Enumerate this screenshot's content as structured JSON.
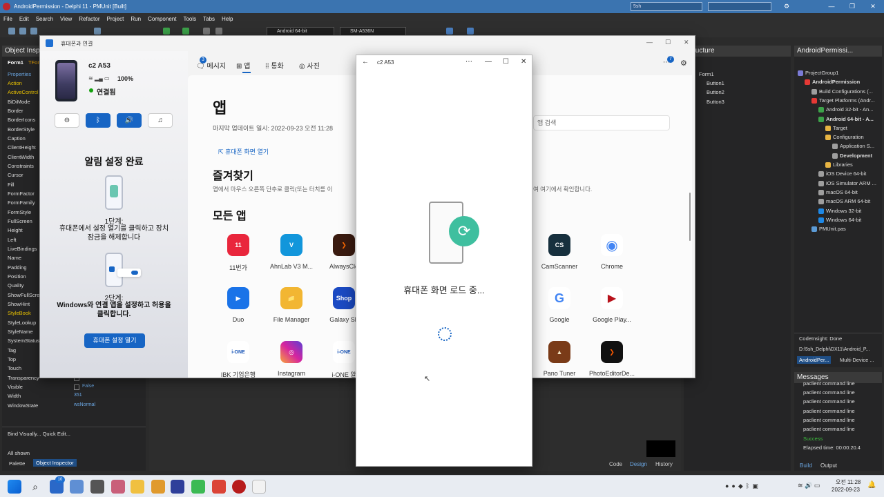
{
  "ide": {
    "title": "AndroidPermission - Delphi 11 - PMUnit [Built]",
    "search_value": "5sh",
    "menu": [
      "File",
      "Edit",
      "Search",
      "View",
      "Refactor",
      "Project",
      "Run",
      "Component",
      "Tools",
      "Tabs",
      "Help"
    ],
    "platform_combo": "Android 64-bit",
    "device_combo": "SM-A536N",
    "object_inspector": {
      "title": "Object Inspector",
      "form_name": "Form1",
      "form_type": "TForm1",
      "tab_properties": "Properties",
      "rows": [
        "Action",
        "ActiveControl",
        "BiDiMode",
        "Border",
        "BorderIcons",
        "BorderStyle",
        "Caption",
        "ClientHeight",
        "ClientWidth",
        "Constraints",
        "Cursor",
        "Fill",
        "FormFactor",
        "FormFamily",
        "FormStyle",
        "FullScreen",
        "Height",
        "Left",
        "LiveBindings",
        "Name",
        "Padding",
        "Position",
        "Quality",
        "ShowFullScreen",
        "ShowHint",
        "StyleBook",
        "StyleLookup",
        "StyleName",
        "SystemStatus",
        "Tag",
        "Top",
        "Touch",
        "Transparency",
        "Visible",
        "Width",
        "WindowState"
      ],
      "transparency_value": "False",
      "visible_value": "False",
      "width_value": "351",
      "windowstate_value": "wsNormal",
      "footer_links": "Bind Visually...  Quick Edit...",
      "all_shown": "All shown",
      "bottom_tabs": [
        "Palette",
        "Object Inspector"
      ]
    },
    "structure": {
      "title": "Structure",
      "items": [
        "Form1",
        "Button1",
        "Button2",
        "Button3"
      ]
    },
    "project_manager": {
      "title": "AndroidPermissi...",
      "items": [
        {
          "label": "ProjectGroup1",
          "indent": 0
        },
        {
          "label": "AndroidPermission",
          "indent": 1,
          "bold": true
        },
        {
          "label": "Build Configurations (...",
          "indent": 2
        },
        {
          "label": "Target Platforms (Andr...",
          "indent": 2
        },
        {
          "label": "Android 32-bit - An...",
          "indent": 3
        },
        {
          "label": "Android 64-bit - A...",
          "indent": 3,
          "bold": true
        },
        {
          "label": "Target",
          "indent": 4
        },
        {
          "label": "Configuration",
          "indent": 4
        },
        {
          "label": "Application S...",
          "indent": 5
        },
        {
          "label": "Development",
          "indent": 5,
          "bold": true
        },
        {
          "label": "Libraries",
          "indent": 4
        },
        {
          "label": "iOS Device 64-bit",
          "indent": 3
        },
        {
          "label": "iOS Simulator ARM ...",
          "indent": 3
        },
        {
          "label": "macOS 64-bit",
          "indent": 3
        },
        {
          "label": "macOS ARM 64-bit",
          "indent": 3
        },
        {
          "label": "Windows 32-bit",
          "indent": 3
        },
        {
          "label": "Windows 64-bit",
          "indent": 3
        },
        {
          "label": "PMUnit.pas",
          "indent": 2
        }
      ],
      "codeinsight": "CodeInsight: Done",
      "path": "D:\\5sh_Delphi\\DX11\\Android_P...",
      "tabs": [
        "AndroidPer...",
        "Multi-Device ..."
      ]
    },
    "messages": {
      "title": "Messages",
      "rows": [
        "paclient command line",
        "paclient command line",
        "paclient command line",
        "paclient command line",
        "paclient command line",
        "paclient command line"
      ],
      "success": "Success",
      "elapsed": "Elapsed time: 00:00:20.4",
      "tabs": [
        "Build",
        "Output"
      ]
    },
    "designer_tabs": [
      "Code",
      "Design",
      "History"
    ]
  },
  "phone_link": {
    "title": "휴대폰과 연결",
    "device_name": "c2 A53",
    "battery": "100%",
    "connected": "연결됨",
    "setup": {
      "title": "알림 설정 완료",
      "step1_heading": "1단계:",
      "step1_text": "휴대폰에서 설정 열기를 클릭하고 장치 잠금을 해제합니다",
      "step2_heading": "2단계:",
      "step2_text": "Windows와 연결 앱을 설정하고 허용을 클릭합니다.",
      "open_button": "휴대폰 설정 열기"
    },
    "tabs": [
      {
        "label": "메시지",
        "badge": "3"
      },
      {
        "label": "앱"
      },
      {
        "label": "통화"
      },
      {
        "label": "사진"
      }
    ],
    "notification_badge": "7",
    "apps_page": {
      "heading": "앱",
      "last_updated": "마지막 업데이트 일시: 2022-09-23 오전 11:28",
      "open_screen_link": "휴대폰 화면 열기",
      "search_placeholder": "앱 검색",
      "favorites_heading": "즐겨찾기",
      "favorites_hint_left": "앱에서 마우스 오른쪽 단추로 클릭(또는 터치를 이",
      "favorites_hint_right": "여 여기에서 확인합니다.",
      "all_apps_heading": "모든 앱",
      "apps_left": [
        {
          "name": "11번가",
          "glyph": "11",
          "color": "#e9263c"
        },
        {
          "name": "AhnLab V3 M...",
          "glyph": "V",
          "color": "#1296db"
        },
        {
          "name": "AlwaysClo",
          "glyph": "❯",
          "color": "#3a1b10"
        },
        {
          "name": "Duo",
          "glyph": "▶",
          "color": "#1a73e8"
        },
        {
          "name": "File Manager",
          "glyph": "📁",
          "color": "#f2b632"
        },
        {
          "name": "Galaxy Sh",
          "glyph": "Shop",
          "color": "#1b4ac3"
        },
        {
          "name": "IBK 기업은행",
          "glyph": "i-ONE",
          "color": "#ffffff"
        },
        {
          "name": "Instagram",
          "glyph": "◎",
          "color": "#d6249f"
        },
        {
          "name": "i-ONE 알",
          "glyph": "i-ONE",
          "color": "#ffffff"
        }
      ],
      "apps_right": [
        {
          "name": "CamScanner",
          "glyph": "CS",
          "color": "#17303e"
        },
        {
          "name": "Chrome",
          "glyph": "◉",
          "color": "#4285f4"
        },
        {
          "name": "Google",
          "glyph": "G",
          "color": "#ffffff"
        },
        {
          "name": "Google Play...",
          "glyph": "▶",
          "color": "#b8121b"
        },
        {
          "name": "Pano Tuner",
          "glyph": "▲",
          "color": "#7a3b18"
        },
        {
          "name": "PhotoEditorDe...",
          "glyph": "❯",
          "color": "#111111"
        }
      ]
    }
  },
  "mirror": {
    "title": "c2 A53",
    "loading_text": "휴대폰 화면 로드 중..."
  },
  "taskbar": {
    "time": "오전 11:28",
    "date": "2022-09-23",
    "mail_badge": "10"
  }
}
